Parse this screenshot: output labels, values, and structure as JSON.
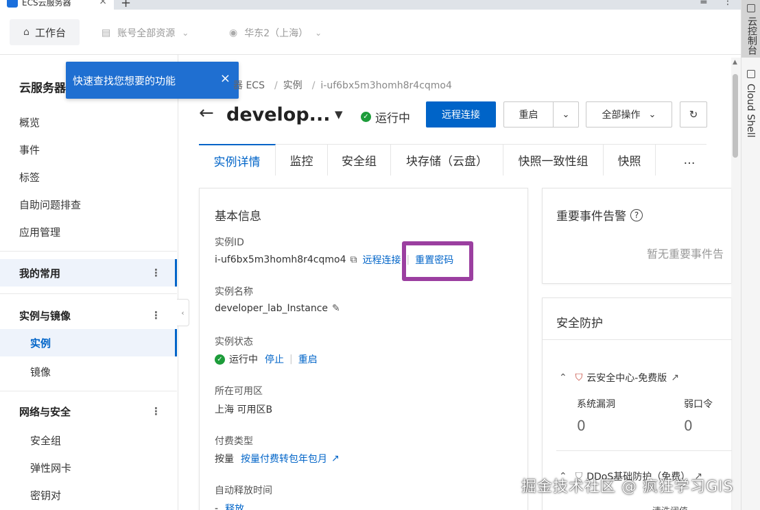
{
  "browser": {
    "tab_title": "ECS云服务器",
    "close": "×",
    "new_tab": "+",
    "menu": "≡",
    "more": "⋮"
  },
  "topbar": {
    "workbench": "工作台",
    "account_resources": "账号全部资源",
    "region": "华东2（上海）"
  },
  "rightstrip": {
    "item1": "云控制台",
    "item2": "Cloud Shell"
  },
  "sidebar": {
    "title": "云服务器",
    "items": [
      "概览",
      "事件",
      "标签",
      "自助问题排查",
      "应用管理"
    ],
    "group_favorites": "我的常用",
    "group_instances": "实例与镜像",
    "instances_sub": [
      "实例",
      "镜像"
    ],
    "group_network": "网络与安全",
    "network_sub": [
      "安全组",
      "弹性网卡",
      "密钥对"
    ],
    "collapse": "‹"
  },
  "tooltip": {
    "text": "快速查找您想要的功能",
    "close": "×"
  },
  "breadcrumb": [
    "器 ECS",
    "实例",
    "i-uf6bx5m3homh8r4cqmo4"
  ],
  "header": {
    "back": "←",
    "title": "develop...",
    "status": "运行中",
    "remote_connect": "远程连接",
    "restart": "重启",
    "all_actions": "全部操作"
  },
  "tabs": [
    "实例详情",
    "监控",
    "安全组",
    "块存储（云盘）",
    "快照一致性组",
    "快照",
    "…"
  ],
  "basic_info": {
    "title": "基本信息",
    "instance_id_label": "实例ID",
    "instance_id": "i-uf6bx5m3homh8r4cqmo4",
    "remote_connect_link": "远程连接",
    "reset_password_link": "重置密码",
    "instance_name_label": "实例名称",
    "instance_name": "developer_lab_Instance",
    "instance_status_label": "实例状态",
    "instance_status": "运行中",
    "stop_link": "停止",
    "restart_link": "重启",
    "zone_label": "所在可用区",
    "zone": "上海 可用区B",
    "billing_label": "付费类型",
    "billing": "按量",
    "billing_convert_link": "按量付费转包年包月",
    "auto_release_label": "自动释放时间",
    "auto_release_dash": "-",
    "auto_release_link": "释放"
  },
  "events": {
    "title": "重要事件告警",
    "empty": "暂无重要事件告"
  },
  "security": {
    "title": "安全防护",
    "security_center": "云安全中心-免费版",
    "vuln_label": "系统漏洞",
    "vuln_value": "0",
    "weak_pwd_label": "弱口令",
    "weak_pwd_value": "0",
    "ddos": "DDoS基础防护（免费）",
    "clean_threshold": "清洗阈值"
  },
  "watermark": "掘金技术社区 @ 疯狂学习GIS",
  "colors": {
    "primary": "#0064c8",
    "success": "#1d9c3a",
    "highlight": "#9b3fa0",
    "tooltip": "#1f6fd1"
  }
}
